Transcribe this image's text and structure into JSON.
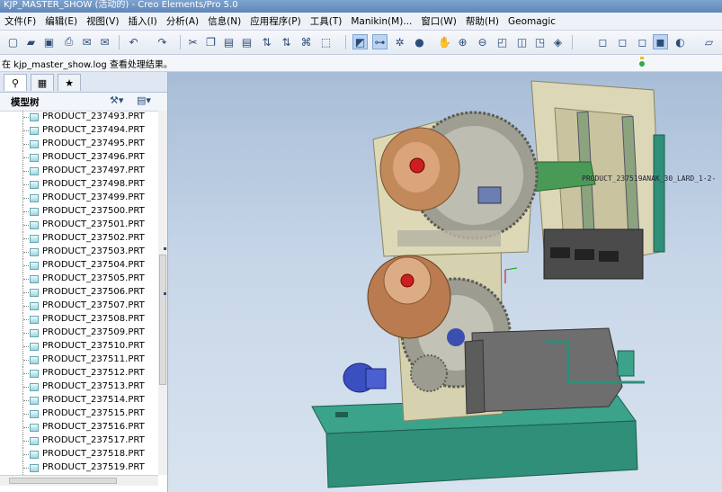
{
  "window": {
    "title": "KJP_MASTER_SHOW (活动的) - Creo Elements/Pro 5.0"
  },
  "menu": [
    "文件(F)",
    "编辑(E)",
    "视图(V)",
    "插入(I)",
    "分析(A)",
    "信息(N)",
    "应用程序(P)",
    "工具(T)",
    "Manikin(M)...",
    "窗口(W)",
    "帮助(H)",
    "Geomagic"
  ],
  "message": "在 kjp_master_show.log 查看处理结果。",
  "panel": {
    "tabs": [
      "model-tree-tab",
      "layers-tab",
      "favorites-tab"
    ],
    "tree_title": "模型树",
    "items": [
      "PRODUCT_237493.PRT",
      "PRODUCT_237494.PRT",
      "PRODUCT_237495.PRT",
      "PRODUCT_237496.PRT",
      "PRODUCT_237497.PRT",
      "PRODUCT_237498.PRT",
      "PRODUCT_237499.PRT",
      "PRODUCT_237500.PRT",
      "PRODUCT_237501.PRT",
      "PRODUCT_237502.PRT",
      "PRODUCT_237503.PRT",
      "PRODUCT_237504.PRT",
      "PRODUCT_237505.PRT",
      "PRODUCT_237506.PRT",
      "PRODUCT_237507.PRT",
      "PRODUCT_237508.PRT",
      "PRODUCT_237509.PRT",
      "PRODUCT_237510.PRT",
      "PRODUCT_237511.PRT",
      "PRODUCT_237512.PRT",
      "PRODUCT_237513.PRT",
      "PRODUCT_237514.PRT",
      "PRODUCT_237515.PRT",
      "PRODUCT_237516.PRT",
      "PRODUCT_237517.PRT",
      "PRODUCT_237518.PRT",
      "PRODUCT_237519.PRT"
    ]
  },
  "viewport": {
    "label": "PRODUCT_237519ANAK_30_LARD_1-2-"
  },
  "colors": {
    "accent": "#7fa6d6",
    "base_plate": "#2f8f79",
    "frame": "#d2cfae",
    "wheel": "#c28a5a",
    "housing": "#6f6f6f"
  }
}
